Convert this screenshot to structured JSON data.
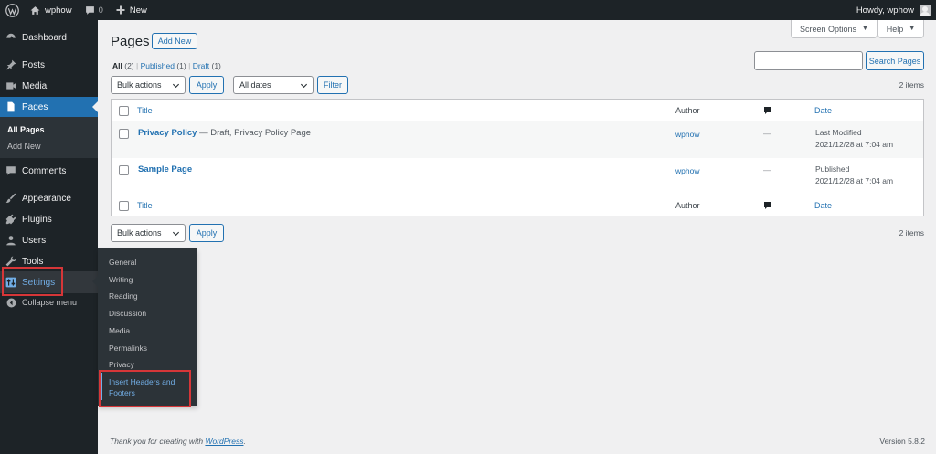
{
  "adminbar": {
    "site_name": "wphow",
    "comment_count": "0",
    "new_label": "New",
    "howdy": "Howdy, wphow"
  },
  "sidebar": {
    "dashboard": "Dashboard",
    "posts": "Posts",
    "media": "Media",
    "pages": "Pages",
    "pages_sub": {
      "all": "All Pages",
      "add": "Add New"
    },
    "comments": "Comments",
    "appearance": "Appearance",
    "plugins": "Plugins",
    "users": "Users",
    "tools": "Tools",
    "settings": "Settings",
    "collapse": "Collapse menu"
  },
  "flyout": {
    "items": [
      "General",
      "Writing",
      "Reading",
      "Discussion",
      "Media",
      "Permalinks",
      "Privacy"
    ],
    "highlight_line1": "Insert Headers and",
    "highlight_line2": "Footers"
  },
  "header": {
    "title": "Pages",
    "add_new": "Add New",
    "screen_options": "Screen Options",
    "help": "Help"
  },
  "views": {
    "all": "All",
    "all_count": "(2)",
    "published": "Published",
    "published_count": "(1)",
    "draft": "Draft",
    "draft_count": "(1)",
    "sep": "|"
  },
  "search": {
    "button": "Search Pages",
    "value": ""
  },
  "filters": {
    "bulk_actions": "Bulk actions",
    "apply": "Apply",
    "all_dates": "All dates",
    "filter": "Filter",
    "items_count": "2 items"
  },
  "table": {
    "columns": {
      "title": "Title",
      "author": "Author",
      "date": "Date"
    },
    "rows": [
      {
        "title": "Privacy Policy",
        "state": " — Draft, Privacy Policy Page",
        "author": "wphow",
        "comments": "—",
        "date_status": "Last Modified",
        "date_value": "2021/12/28 at 7:04 am"
      },
      {
        "title": "Sample Page",
        "state": "",
        "author": "wphow",
        "comments": "—",
        "date_status": "Published",
        "date_value": "2021/12/28 at 7:04 am"
      }
    ]
  },
  "footer": {
    "thanks": "Thank you for creating with",
    "wp_link": "WordPress",
    "period": ".",
    "version": "Version 5.8.2"
  },
  "colors": {
    "admin_dark": "#1d2327",
    "accent_blue": "#2271b1",
    "highlight_red": "#d63638",
    "link_light": "#72aee6"
  }
}
